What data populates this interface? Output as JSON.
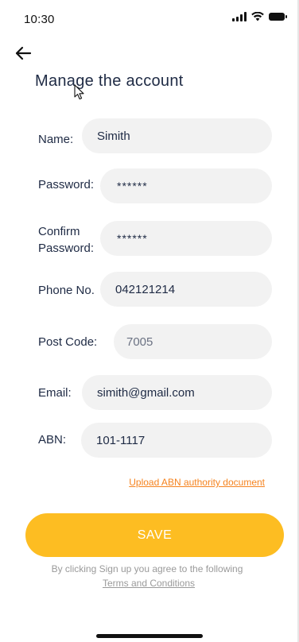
{
  "status_bar": {
    "time": "10:30"
  },
  "header": {
    "title": "Manage the account"
  },
  "form": {
    "name": {
      "label": "Name:",
      "value": "Simith"
    },
    "password": {
      "label": "Password:",
      "value": "******"
    },
    "confirm_password": {
      "label_line1": "Confirm",
      "label_line2": "Password:",
      "value": "******"
    },
    "phone": {
      "label": "Phone No.",
      "value": "042121214"
    },
    "post_code": {
      "label": "Post Code:",
      "placeholder": "7005"
    },
    "email": {
      "label": "Email:",
      "value": "simith@gmail.com"
    },
    "abn": {
      "label": "ABN:",
      "value": "101-1117"
    }
  },
  "upload_link": "Upload ABN authority document",
  "save_label": "SAVE",
  "terms": {
    "text": "By clicking Sign up you agree to the following",
    "link": "Terms and Conditions"
  },
  "colors": {
    "accent": "#fdbd22",
    "link": "#f5831f",
    "text": "#1e2a44",
    "field_bg": "#f2f2f2"
  },
  "icons": {
    "back": "arrow-left-icon",
    "signal": "cellular-signal-icon",
    "wifi": "wifi-icon",
    "battery": "battery-icon"
  }
}
